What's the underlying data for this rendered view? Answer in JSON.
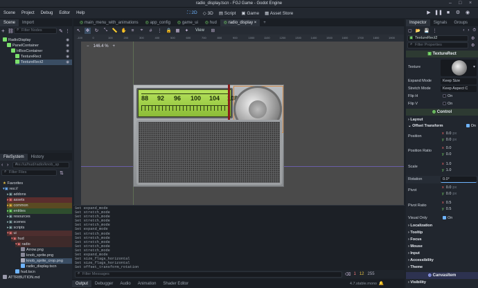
{
  "window": {
    "title": "radio_display.tscn - FGJ Game - Godot Engine"
  },
  "menubar": {
    "items": [
      "Scene",
      "Project",
      "Debug",
      "Editor",
      "Help"
    ],
    "workspaces": [
      "2D",
      "3D",
      "Script",
      "Game",
      "Asset Store"
    ]
  },
  "scene_dock": {
    "tabs": [
      "Scene",
      "Import"
    ],
    "filter_placeholder": "Filter Nodes",
    "nodes": [
      "RadioDisplay",
      "PanelContainer",
      "HBoxContainer",
      "TextureRect",
      "TextureRect2"
    ]
  },
  "filesystem_dock": {
    "tabs": [
      "FileSystem",
      "History"
    ],
    "path": "res://ui/hud/radio/knob_sp",
    "filter_placeholder": "Filter Files",
    "items": [
      "Favorites",
      "res://",
      "addons",
      "assets",
      "common",
      "entities",
      "resources",
      "scenes",
      "scripts",
      "ui",
      "hud",
      "radio",
      "Arrow.png",
      "knob_sprite.png",
      "knob_sprite_crop.png",
      "radio_display.tscn",
      "hud.tscn",
      "ATTRIBUTION.md"
    ]
  },
  "scene_tabs": [
    "main_menu_with_animations",
    "app_config",
    "game_ui",
    "hud",
    "radio_display"
  ],
  "viewport": {
    "zoom": "146.4 %",
    "view_menu": "View",
    "ruler_ticks": [
      "-100",
      "0",
      "100",
      "200",
      "300",
      "400",
      "500",
      "600",
      "700",
      "800",
      "900",
      "1000",
      "1100",
      "1200",
      "1300",
      "1400",
      "1500",
      "1600",
      "1700",
      "1800",
      "1900"
    ],
    "dial_numbers": [
      "88",
      "92",
      "96",
      "100",
      "104",
      "108"
    ]
  },
  "console": {
    "lines": [
      "Set expand_mode",
      "Set stretch_mode",
      "Set stretch_mode",
      "Set stretch_mode",
      "Set stretch_mode",
      "Set expand_mode",
      "Set stretch_mode",
      "Set stretch_mode",
      "Set stretch_mode",
      "Set stretch_mode",
      "Set stretch_mode",
      "Set expand_mode",
      "Set size_flags_horizontal",
      "Set size_flags_horizontal",
      "Set offset_transform_rotation"
    ],
    "filter_placeholder": "Filter Messages",
    "bottom_tabs": [
      "Output",
      "Debugger",
      "Audio",
      "Animation",
      "Shader Editor"
    ],
    "version": "4.7.stable.mono",
    "counts": [
      "1",
      "12",
      "255"
    ]
  },
  "inspector": {
    "tabs": [
      "Inspector",
      "Signals",
      "Groups"
    ],
    "node_field": "TextureRect2",
    "filter_placeholder": "Filter Properties",
    "class_header": "TextureRect",
    "texture_label": "Texture",
    "expand_mode": {
      "label": "Expand Mode",
      "value": "Keep Size"
    },
    "stretch_mode": {
      "label": "Stretch Mode",
      "value": "Keep Aspect C"
    },
    "flip_h": {
      "label": "Flip H",
      "value": "On"
    },
    "flip_v": {
      "label": "Flip V",
      "value": "On"
    },
    "control_header": "Control",
    "sections": {
      "layout": "Layout",
      "offset_transform": "Offset Transform",
      "enabled": "On"
    },
    "position": {
      "label": "Position",
      "x": "0.0",
      "y": "0.0",
      "unit": "px"
    },
    "position_ratio": {
      "label": "Position Ratio",
      "x": "0.0",
      "y": "0.0"
    },
    "scale": {
      "label": "Scale",
      "x": "1.0",
      "y": "1.0"
    },
    "rotation": {
      "label": "Rotation",
      "value": "0.0",
      "unit": "°"
    },
    "pivot": {
      "label": "Pivot",
      "x": "0.0",
      "y": "0.0",
      "unit": "px"
    },
    "pivot_ratio": {
      "label": "Pivot Ratio",
      "x": "0.5",
      "y": "0.5"
    },
    "visual_only": {
      "label": "Visual Only",
      "value": "On"
    },
    "groups": [
      "Localization",
      "Tooltip",
      "Focus",
      "Mouse",
      "Input",
      "Accessibility",
      "Theme"
    ],
    "canvasitem_header": "CanvasItem",
    "visibility": "Visibility"
  },
  "colors": {
    "accent": "#6fb4ff",
    "lcd": "#a4d64a",
    "selection": "#3a4d63",
    "needle": "#8b1a1a"
  }
}
